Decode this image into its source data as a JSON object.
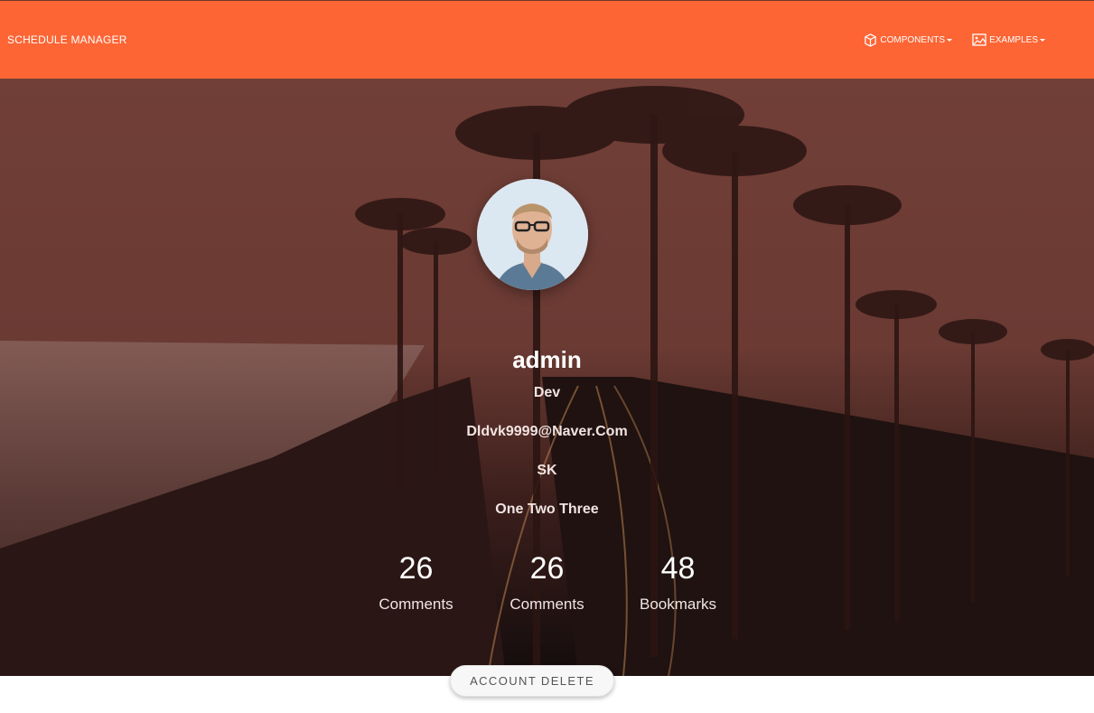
{
  "navbar": {
    "brand": "SCHEDULE MANAGER",
    "links": [
      {
        "label": "COMPONENTS",
        "icon": "cube-icon"
      },
      {
        "label": "EXAMPLES",
        "icon": "image-icon"
      }
    ]
  },
  "profile": {
    "name": "admin",
    "role": "Dev",
    "email": "Dldvk9999@Naver.Com",
    "company": "SK",
    "address": "One Two Three"
  },
  "stats": [
    {
      "value": "26",
      "label": "Comments"
    },
    {
      "value": "26",
      "label": "Comments"
    },
    {
      "value": "48",
      "label": "Bookmarks"
    }
  ],
  "actions": {
    "delete_label": "ACCOUNT DELETE"
  },
  "colors": {
    "navbar": "#fd6535",
    "hero_overlay": "#6a3a33"
  }
}
